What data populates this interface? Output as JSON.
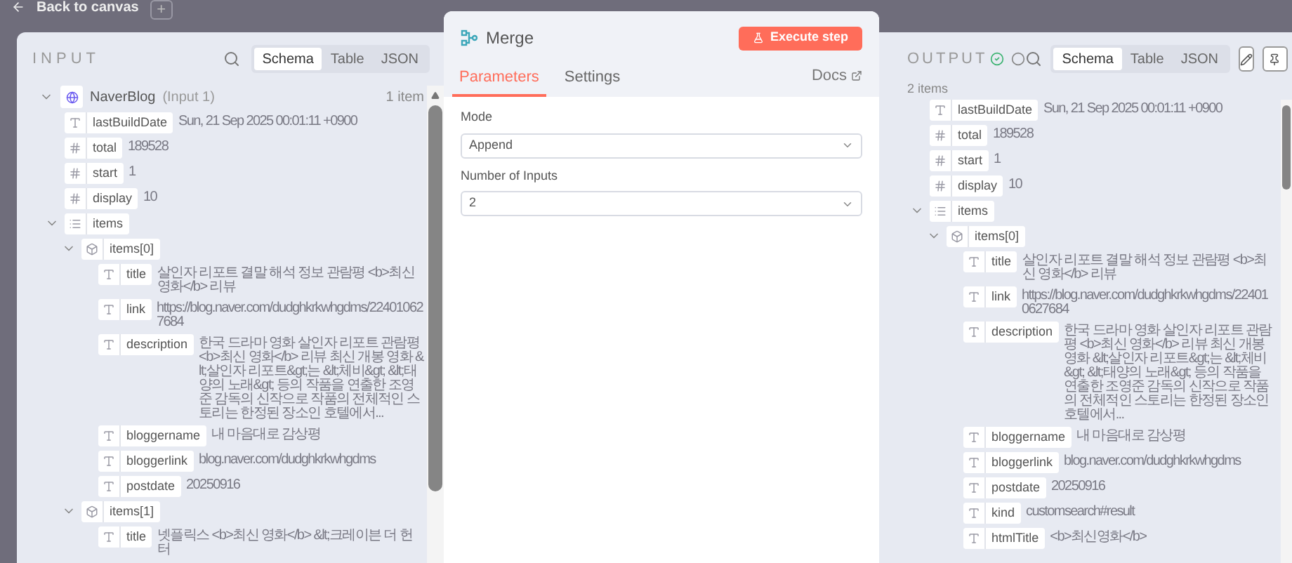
{
  "canvas": {
    "back_label": "Back to canvas",
    "add_label": "+"
  },
  "input": {
    "title": "INPUT",
    "tabs": [
      {
        "label": "Schema",
        "selected": true
      },
      {
        "label": "Table",
        "selected": false
      },
      {
        "label": "JSON",
        "selected": false
      }
    ],
    "source": {
      "name": "NaverBlog",
      "tag": "(Input 1)",
      "count": "1 item",
      "expanded": true
    },
    "fields": [
      {
        "kind": "string",
        "key": "lastBuildDate",
        "value": "Sun, 21 Sep 2025 00:01:11 +0900"
      },
      {
        "kind": "number",
        "key": "total",
        "value": "189528"
      },
      {
        "kind": "number",
        "key": "start",
        "value": "1"
      },
      {
        "kind": "number",
        "key": "display",
        "value": "10"
      },
      {
        "kind": "array",
        "key": "items",
        "expanded": true,
        "children": [
          {
            "kind": "object",
            "key": "items[0]",
            "expanded": true,
            "children": [
              {
                "kind": "string",
                "key": "title",
                "value": "살인자 리포트 결말 해석 정보 관람평 <b>최신 영화</b> 리뷰"
              },
              {
                "kind": "string",
                "key": "link",
                "value": "https://blog.naver.com/dudghkrkwhgdms/224010627684"
              },
              {
                "kind": "string",
                "key": "description",
                "value": "한국 드라마 영화 살인자 리포트 관람평 <b>최신 영화</b> 리뷰 최신 개봉 영화 &lt;살인자 리포트&gt;는 &lt;체비&gt; &lt;태양의 노래&gt; 등의 작품을 연출한 조영준 감독의 신작으로 작품의 전체적인 스토리는 한정된 장소인 호텔에서..."
              },
              {
                "kind": "string",
                "key": "bloggername",
                "value": "내 마음대로 감상평"
              },
              {
                "kind": "string",
                "key": "bloggerlink",
                "value": "blog.naver.com/dudghkrkwhgdms"
              },
              {
                "kind": "string",
                "key": "postdate",
                "value": "20250916"
              }
            ]
          },
          {
            "kind": "object",
            "key": "items[1]",
            "expanded": true,
            "children": [
              {
                "kind": "string",
                "key": "title",
                "value": "넷플릭스 <b>최신 영화</b> &lt;크레이븐 더 헌터"
              }
            ]
          }
        ]
      }
    ]
  },
  "node": {
    "title": "Merge",
    "execute_label": "Execute step",
    "tabs": [
      {
        "label": "Parameters",
        "selected": true
      },
      {
        "label": "Settings",
        "selected": false
      }
    ],
    "docs_label": "Docs",
    "params": [
      {
        "label": "Mode",
        "value": "Append"
      },
      {
        "label": "Number of Inputs",
        "value": "2"
      }
    ]
  },
  "output": {
    "title": "OUTPUT",
    "count": "2 items",
    "tabs": [
      {
        "label": "Schema",
        "selected": true
      },
      {
        "label": "Table",
        "selected": false
      },
      {
        "label": "JSON",
        "selected": false
      }
    ],
    "fields": [
      {
        "kind": "string",
        "key": "lastBuildDate",
        "value": "Sun, 21 Sep 2025 00:01:11 +0900"
      },
      {
        "kind": "number",
        "key": "total",
        "value": "189528"
      },
      {
        "kind": "number",
        "key": "start",
        "value": "1"
      },
      {
        "kind": "number",
        "key": "display",
        "value": "10"
      },
      {
        "kind": "array",
        "key": "items",
        "expanded": true,
        "children": [
          {
            "kind": "object",
            "key": "items[0]",
            "expanded": true,
            "children": [
              {
                "kind": "string",
                "key": "title",
                "value": "살인자 리포트 결말 해석 정보 관람평 <b>최신 영화</b> 리뷰"
              },
              {
                "kind": "string",
                "key": "link",
                "value": "https://blog.naver.com/dudghkrkwhgdms/224010627684"
              },
              {
                "kind": "string",
                "key": "description",
                "value": "한국 드라마 영화 살인자 리포트 관람평 <b>최신 영화</b> 리뷰 최신 개봉 영화 &lt;살인자 리포트&gt;는 &lt;체비&gt; &lt;태양의 노래&gt; 등의 작품을 연출한 조영준 감독의 신작으로 작품의 전체적인 스토리는 한정된 장소인 호텔에서..."
              },
              {
                "kind": "string",
                "key": "bloggername",
                "value": "내 마음대로 감상평"
              },
              {
                "kind": "string",
                "key": "bloggerlink",
                "value": "blog.naver.com/dudghkrkwhgdms"
              },
              {
                "kind": "string",
                "key": "postdate",
                "value": "20250916"
              },
              {
                "kind": "string",
                "key": "kind",
                "value": "customsearch#result"
              },
              {
                "kind": "string",
                "key": "htmlTitle",
                "value": "<b>최신영화</b>"
              }
            ]
          }
        ]
      }
    ]
  }
}
